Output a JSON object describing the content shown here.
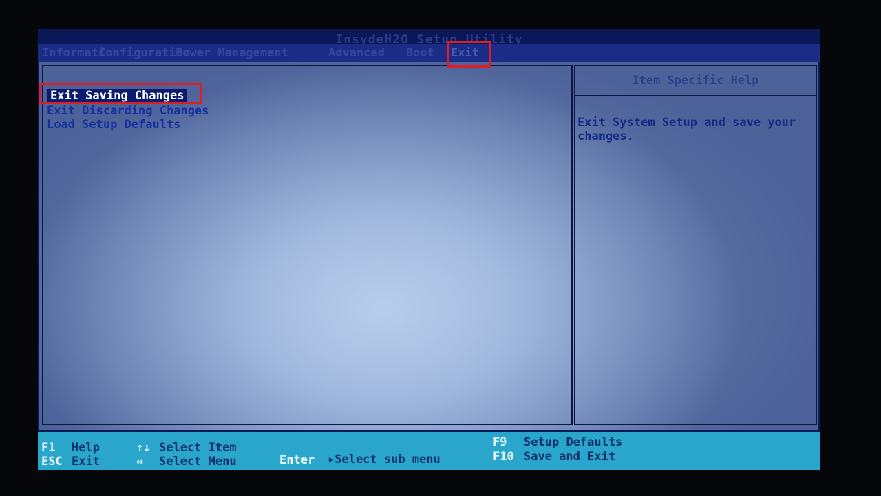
{
  "app": {
    "title": "InsydeH2O Setup Utility"
  },
  "menu": {
    "items": [
      {
        "label": "Information"
      },
      {
        "label": "Configuration"
      },
      {
        "label": "Power Management"
      },
      {
        "label": "Advanced"
      },
      {
        "label": "Boot"
      },
      {
        "label": "Exit",
        "active": true
      }
    ]
  },
  "options": {
    "items": [
      {
        "label": "Exit Saving Changes",
        "selected": true
      },
      {
        "label": "Exit Discarding Changes"
      },
      {
        "label": "Load Setup Defaults"
      }
    ]
  },
  "help": {
    "title": "Item Specific Help",
    "text": "Exit System Setup and save your changes."
  },
  "status": {
    "f1_key": "F1",
    "f1_desc": "Help",
    "esc_key": "ESC",
    "esc_desc": "Exit",
    "updown_key": "↑↓",
    "updown_desc": "Select Item",
    "leftright_key": "↔",
    "leftright_desc": "Select Menu",
    "enter_key": "Enter",
    "enter_desc": "▸Select sub menu",
    "f9_key": "F9",
    "f9_desc": "Setup Defaults",
    "f10_key": "F10",
    "f10_desc": "Save and Exit"
  },
  "annotations": {
    "highlight_color": "#e01c24"
  }
}
